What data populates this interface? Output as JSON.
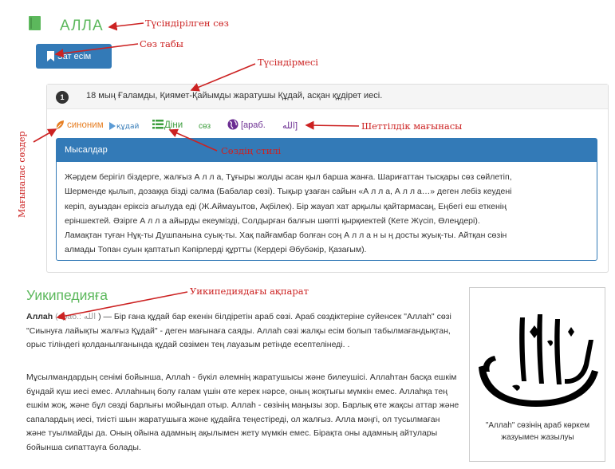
{
  "word": {
    "title": "АЛЛА",
    "part_of_speech": "Зат есім"
  },
  "definition": {
    "number": "1",
    "text": "18 мың Ғаламды, Қиямет-Қайымды жаратушы Құдай, асқан құдірет иесі."
  },
  "tags": {
    "synonym": "синоним",
    "word": "құдай",
    "style_religious": "Діни",
    "style_word": "сөз",
    "origin": "[араб.",
    "origin_script": "الله]"
  },
  "examples": {
    "header": "Мысалдар",
    "lines": [
      "Жәрдем берігіл біздерге, жалғыз А л л а, Тұғыры жолды асан қыл барша жанға. Шариғаттан тысқары сөз сөйлетіп,",
      "Шерменде қылып, дозаққа бізді салма (Бабалар сөзі). Тықыр ұзаған сайын «А л л а, А л л а…» деген лебіз кеудені",
      "керіп, ауыздан еріксіз ағылуда еді (Ж.Аймауытов, Ақбілек). Бір жауап хат арқылы қайтармасаң, Еңбегі еш еткенің",
      "еріншектей. Әзірге А л л а айырды екеуміздi, Солдырған балғын шөпті қырқиектей (Кете Жүсіп, Өлеңдері).",
      "Ламақтан туған Нұқ-ты Душпанына суық-ты. Хақ пайғамбар болған соң А л л а н ы ң досты жуық-ты. Айтқан сөзін",
      "алмады Топан суын қаптатып Кәпірлерді құртты (Кердері Әбубәкір, Қазағым)."
    ]
  },
  "wiki": {
    "title": "Уикипедияға",
    "term": "Аллаһ",
    "term_origin_label": "(араб.:",
    "term_origin_script": "الله",
    "p1_rest": ") — Бір ғана құдай бар екенін білдіретін араб сөзі. Араб сөздіктеріне суйенсек \"Аллаһ\" сөзі \"Сиынуға лайықты жалғыз Құдай\" - деген мағынаға саяды. Аллаһ сөзі жалқы есім болып табылмағандықтан, орыс тіліндегі қолданылғанында құдай сөзімен тең лауазым ретінде есептелінеді. .",
    "p2": "Мұсылмандардың сенімі бойынша, Аллаһ - бүкіл әлемнің жаратушысы және билеушісі. Аллаһтан басқа ешкім бұндай күш иесі емес. Аллаһның болу ғалам үшін өте керек нәрсе, оның жоқтығы мүмкін емес. Аллаһқа тең ешкім жоқ, және бұл сөзді барлығы мойындап отыр. Аллаһ - сөзінің маңызы зор. Барлық өте жақсы аттар және сапалардың иесі, тиісті шын жаратушыға және құдайға теңестіреді, ол жалғыз. Алла мәңгі, ол тусылмаған және туылмайды да. Оның ойына адамның ақылымен жету мүмкін емес. Бірақта оны адамның айтулары бойынша сипаттауға болады.",
    "figure_caption": "\"Аллаһ\" сөзінің араб көркем жазуымен жазылуы"
  },
  "annotations": {
    "explained_word": "Түсіндірілген сөз",
    "word_class": "Сөз табы",
    "explanation": "Түсіндірмесі",
    "foreign_meaning": "Шеттілдік мағынасы",
    "word_style": "Сөздің стилі",
    "related_words": "Мағыналас сөздер",
    "wiki_info": "Уикипедиядағы ақпарат"
  },
  "colors": {
    "accent_green": "#5cb85c",
    "primary_blue": "#337ab7",
    "annotation_red": "#cc2222",
    "origin_purple": "#6a2c91",
    "synonym_orange": "#e67e22"
  }
}
